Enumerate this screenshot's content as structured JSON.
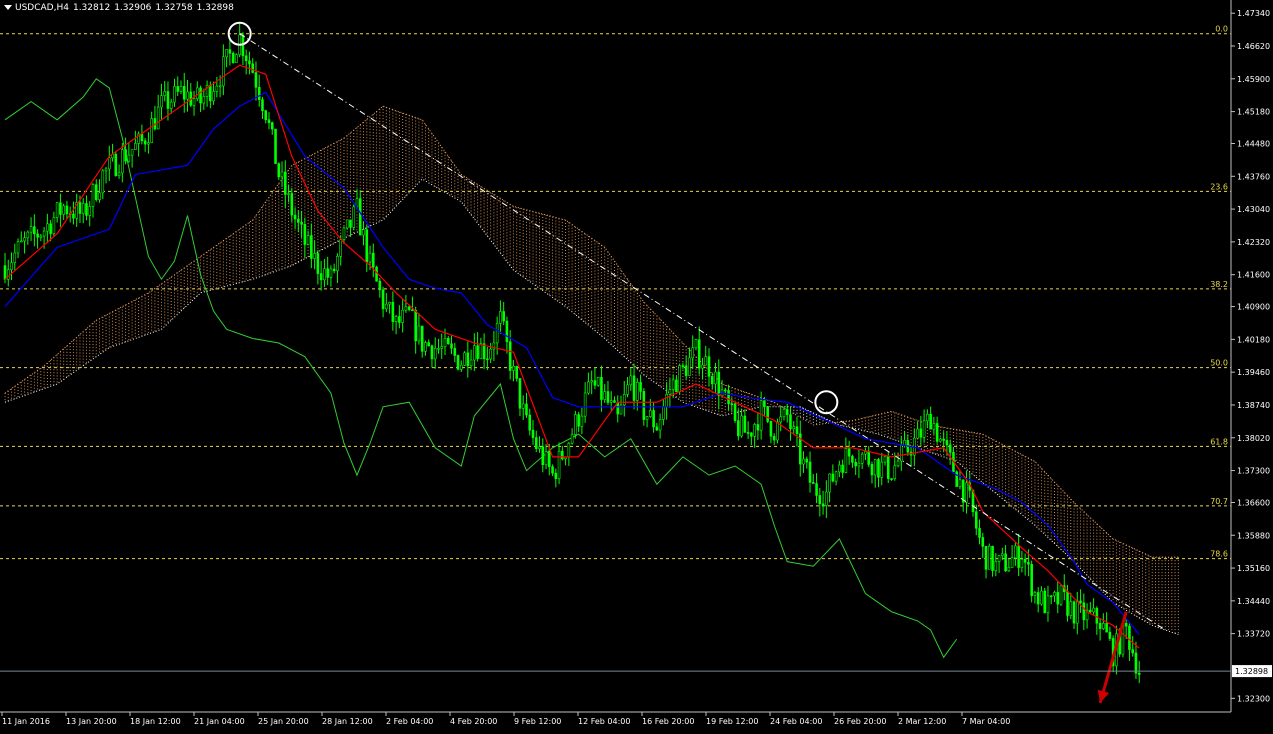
{
  "header": {
    "symbol": "USDCAD,H4",
    "open": "1.32812",
    "high": "1.32906",
    "low": "1.32758",
    "close": "1.32898"
  },
  "colors": {
    "background": "#000000",
    "candles": "#00ff00",
    "tenkan": "#ff0000",
    "kijun": "#0000ff",
    "chikou": "#32cd32",
    "cloud_bear": "#ffffff",
    "cloud_bull": "#f4a460",
    "fib_levels": "#e6d84a",
    "trendline": "#ffffff",
    "arrow": "#cc0000",
    "axis": "#c0c0c0",
    "current_price_line": "#778899"
  },
  "chart_data": {
    "type": "candlestick",
    "symbol": "USDCAD",
    "timeframe": "H4",
    "ylim": [
      1.32,
      1.4763
    ],
    "y_ticks": [
      "1.47340",
      "1.46620",
      "1.45900",
      "1.45180",
      "1.44480",
      "1.43760",
      "1.43040",
      "1.42320",
      "1.41600",
      "1.40900",
      "1.40180",
      "1.39460",
      "1.38740",
      "1.38020",
      "1.37300",
      "1.36600",
      "1.35880",
      "1.35160",
      "1.34440",
      "1.33720",
      "1.32300"
    ],
    "current_price": "1.32898",
    "x_ticks": [
      "11 Jan 2016",
      "13 Jan 20:00",
      "18 Jan 12:00",
      "21 Jan 04:00",
      "25 Jan 20:00",
      "28 Jan 12:00",
      "2 Feb 04:00",
      "4 Feb 20:00",
      "9 Feb 12:00",
      "12 Feb 04:00",
      "16 Feb 20:00",
      "19 Feb 12:00",
      "24 Feb 04:00",
      "26 Feb 20:00",
      "2 Mar 12:00",
      "7 Mar 04:00"
    ],
    "fibonacci": {
      "high": 1.4689,
      "low": 1.3223,
      "levels": [
        {
          "label": "0.0",
          "ratio": 0.0
        },
        {
          "label": "23.6",
          "ratio": 0.236
        },
        {
          "label": "38.2",
          "ratio": 0.382
        },
        {
          "label": "50.0",
          "ratio": 0.5
        },
        {
          "label": "61.8",
          "ratio": 0.618
        },
        {
          "label": "70.7",
          "ratio": 0.707
        },
        {
          "label": "78.6",
          "ratio": 0.786
        }
      ]
    },
    "close_path": [
      [
        0,
        1.418
      ],
      [
        3,
        1.423
      ],
      [
        6,
        1.426
      ],
      [
        9,
        1.431
      ],
      [
        12,
        1.429
      ],
      [
        15,
        1.438
      ],
      [
        18,
        1.442
      ],
      [
        21,
        1.445
      ],
      [
        24,
        1.453
      ],
      [
        27,
        1.456
      ],
      [
        30,
        1.454
      ],
      [
        33,
        1.46
      ],
      [
        36,
        1.468
      ],
      [
        38,
        1.461
      ],
      [
        40,
        1.452
      ],
      [
        42,
        1.438
      ],
      [
        44,
        1.43
      ],
      [
        46,
        1.423
      ],
      [
        48,
        1.418
      ],
      [
        50,
        1.415
      ],
      [
        52,
        1.424
      ],
      [
        54,
        1.43
      ],
      [
        56,
        1.418
      ],
      [
        58,
        1.41
      ],
      [
        60,
        1.405
      ],
      [
        62,
        1.407
      ],
      [
        64,
        1.401
      ],
      [
        66,
        1.4
      ],
      [
        68,
        1.399
      ],
      [
        70,
        1.397
      ],
      [
        72,
        1.401
      ],
      [
        74,
        1.399
      ],
      [
        76,
        1.406
      ],
      [
        78,
        1.394
      ],
      [
        80,
        1.383
      ],
      [
        82,
        1.377
      ],
      [
        84,
        1.372
      ],
      [
        86,
        1.378
      ],
      [
        88,
        1.385
      ],
      [
        90,
        1.392
      ],
      [
        92,
        1.389
      ],
      [
        94,
        1.384
      ],
      [
        96,
        1.393
      ],
      [
        98,
        1.386
      ],
      [
        100,
        1.383
      ],
      [
        102,
        1.391
      ],
      [
        104,
        1.395
      ],
      [
        106,
        1.399
      ],
      [
        108,
        1.396
      ],
      [
        110,
        1.39
      ],
      [
        112,
        1.383
      ],
      [
        114,
        1.381
      ],
      [
        116,
        1.386
      ],
      [
        118,
        1.382
      ],
      [
        120,
        1.385
      ],
      [
        122,
        1.376
      ],
      [
        124,
        1.369
      ],
      [
        126,
        1.368
      ],
      [
        128,
        1.375
      ],
      [
        130,
        1.377
      ],
      [
        132,
        1.376
      ],
      [
        134,
        1.374
      ],
      [
        136,
        1.373
      ],
      [
        138,
        1.377
      ],
      [
        140,
        1.38
      ],
      [
        142,
        1.385
      ],
      [
        144,
        1.378
      ],
      [
        146,
        1.372
      ],
      [
        148,
        1.366
      ],
      [
        150,
        1.355
      ],
      [
        152,
        1.352
      ],
      [
        154,
        1.353
      ],
      [
        156,
        1.355
      ],
      [
        158,
        1.346
      ],
      [
        160,
        1.343
      ],
      [
        162,
        1.345
      ],
      [
        164,
        1.342
      ],
      [
        166,
        1.341
      ],
      [
        168,
        1.34
      ],
      [
        170,
        1.333
      ],
      [
        172,
        1.338
      ],
      [
        174,
        1.329
      ]
    ],
    "tenkan_path": [
      [
        0,
        1.415
      ],
      [
        8,
        1.425
      ],
      [
        16,
        1.442
      ],
      [
        24,
        1.45
      ],
      [
        30,
        1.456
      ],
      [
        36,
        1.462
      ],
      [
        40,
        1.46
      ],
      [
        44,
        1.442
      ],
      [
        48,
        1.43
      ],
      [
        52,
        1.423
      ],
      [
        56,
        1.418
      ],
      [
        60,
        1.412
      ],
      [
        66,
        1.404
      ],
      [
        72,
        1.401
      ],
      [
        78,
        1.399
      ],
      [
        84,
        1.376
      ],
      [
        88,
        1.376
      ],
      [
        94,
        1.388
      ],
      [
        100,
        1.388
      ],
      [
        106,
        1.392
      ],
      [
        112,
        1.388
      ],
      [
        118,
        1.384
      ],
      [
        124,
        1.378
      ],
      [
        130,
        1.378
      ],
      [
        136,
        1.376
      ],
      [
        140,
        1.377
      ],
      [
        144,
        1.378
      ],
      [
        148,
        1.37
      ],
      [
        150,
        1.364
      ],
      [
        156,
        1.356
      ],
      [
        160,
        1.351
      ],
      [
        166,
        1.342
      ],
      [
        170,
        1.339
      ],
      [
        174,
        1.334
      ]
    ],
    "kijun_path": [
      [
        0,
        1.409
      ],
      [
        8,
        1.422
      ],
      [
        16,
        1.426
      ],
      [
        20,
        1.438
      ],
      [
        28,
        1.44
      ],
      [
        32,
        1.448
      ],
      [
        36,
        1.453
      ],
      [
        40,
        1.456
      ],
      [
        46,
        1.442
      ],
      [
        52,
        1.435
      ],
      [
        58,
        1.422
      ],
      [
        62,
        1.415
      ],
      [
        66,
        1.413
      ],
      [
        70,
        1.412
      ],
      [
        74,
        1.405
      ],
      [
        80,
        1.4
      ],
      [
        84,
        1.389
      ],
      [
        88,
        1.387
      ],
      [
        96,
        1.387
      ],
      [
        104,
        1.387
      ],
      [
        110,
        1.39
      ],
      [
        114,
        1.389
      ],
      [
        120,
        1.388
      ],
      [
        126,
        1.384
      ],
      [
        132,
        1.38
      ],
      [
        140,
        1.378
      ],
      [
        146,
        1.372
      ],
      [
        152,
        1.369
      ],
      [
        156,
        1.366
      ],
      [
        160,
        1.361
      ],
      [
        164,
        1.353
      ],
      [
        166,
        1.348
      ],
      [
        170,
        1.344
      ],
      [
        174,
        1.337
      ]
    ],
    "chikou_path": [
      [
        0,
        1.45
      ],
      [
        4,
        1.454
      ],
      [
        8,
        1.45
      ],
      [
        12,
        1.455
      ],
      [
        14,
        1.459
      ],
      [
        16,
        1.457
      ],
      [
        18,
        1.446
      ],
      [
        20,
        1.433
      ],
      [
        22,
        1.42
      ],
      [
        24,
        1.415
      ],
      [
        26,
        1.419
      ],
      [
        28,
        1.429
      ],
      [
        30,
        1.416
      ],
      [
        32,
        1.408
      ],
      [
        34,
        1.404
      ],
      [
        38,
        1.402
      ],
      [
        42,
        1.401
      ],
      [
        46,
        1.398
      ],
      [
        50,
        1.39
      ],
      [
        52,
        1.379
      ],
      [
        54,
        1.372
      ],
      [
        56,
        1.379
      ],
      [
        58,
        1.387
      ],
      [
        62,
        1.388
      ],
      [
        66,
        1.378
      ],
      [
        70,
        1.374
      ],
      [
        72,
        1.385
      ],
      [
        76,
        1.392
      ],
      [
        78,
        1.38
      ],
      [
        80,
        1.373
      ],
      [
        84,
        1.378
      ],
      [
        88,
        1.381
      ],
      [
        92,
        1.376
      ],
      [
        96,
        1.38
      ],
      [
        100,
        1.37
      ],
      [
        104,
        1.376
      ],
      [
        108,
        1.372
      ],
      [
        112,
        1.374
      ],
      [
        116,
        1.37
      ],
      [
        118,
        1.361
      ],
      [
        120,
        1.353
      ],
      [
        124,
        1.352
      ],
      [
        128,
        1.358
      ],
      [
        132,
        1.346
      ],
      [
        136,
        1.342
      ],
      [
        140,
        1.34
      ],
      [
        142,
        1.338
      ],
      [
        144,
        1.332
      ],
      [
        146,
        1.336
      ]
    ],
    "cloud_span_a": [
      [
        0,
        1.39
      ],
      [
        6,
        1.396
      ],
      [
        14,
        1.406
      ],
      [
        22,
        1.412
      ],
      [
        30,
        1.42
      ],
      [
        38,
        1.428
      ],
      [
        44,
        1.44
      ],
      [
        52,
        1.446
      ],
      [
        58,
        1.453
      ],
      [
        64,
        1.45
      ],
      [
        70,
        1.438
      ],
      [
        78,
        1.431
      ],
      [
        86,
        1.428
      ],
      [
        92,
        1.422
      ],
      [
        98,
        1.41
      ],
      [
        104,
        1.401
      ],
      [
        110,
        1.392
      ],
      [
        118,
        1.388
      ],
      [
        124,
        1.383
      ],
      [
        130,
        1.384
      ],
      [
        136,
        1.386
      ],
      [
        142,
        1.383
      ],
      [
        150,
        1.381
      ],
      [
        158,
        1.375
      ],
      [
        164,
        1.366
      ],
      [
        170,
        1.358
      ],
      [
        176,
        1.354
      ],
      [
        180,
        1.354
      ]
    ],
    "cloud_span_b": [
      [
        0,
        1.388
      ],
      [
        8,
        1.392
      ],
      [
        16,
        1.4
      ],
      [
        24,
        1.404
      ],
      [
        30,
        1.412
      ],
      [
        38,
        1.415
      ],
      [
        44,
        1.418
      ],
      [
        52,
        1.424
      ],
      [
        58,
        1.428
      ],
      [
        64,
        1.437
      ],
      [
        70,
        1.432
      ],
      [
        78,
        1.417
      ],
      [
        86,
        1.409
      ],
      [
        92,
        1.402
      ],
      [
        98,
        1.394
      ],
      [
        104,
        1.388
      ],
      [
        110,
        1.385
      ],
      [
        116,
        1.387
      ],
      [
        122,
        1.387
      ],
      [
        128,
        1.383
      ],
      [
        134,
        1.381
      ],
      [
        140,
        1.378
      ],
      [
        146,
        1.375
      ],
      [
        152,
        1.368
      ],
      [
        158,
        1.361
      ],
      [
        164,
        1.353
      ],
      [
        170,
        1.344
      ],
      [
        176,
        1.339
      ],
      [
        180,
        1.337
      ]
    ],
    "trendline": {
      "from": [
        36,
        1.4689
      ],
      "to": [
        178,
        1.338
      ]
    },
    "highlighted_points": [
      [
        36,
        1.4689
      ],
      [
        126,
        1.388
      ]
    ],
    "forecast_arrow": {
      "from": [
        172,
        1.342
      ],
      "to": [
        168,
        1.322
      ]
    }
  }
}
